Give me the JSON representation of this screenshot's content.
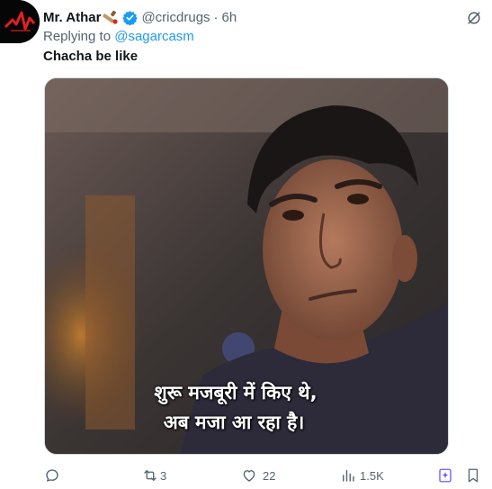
{
  "tweet": {
    "author_name": "Mr. Athar",
    "handle": "@cricdrugs",
    "separator": "·",
    "time": "6h",
    "replying_prefix": "Replying to",
    "replying_to": "@sagarcasm",
    "text": "Chacha be like"
  },
  "media": {
    "subtitle_line1": "शुरू मजबूरी में किए थे,",
    "subtitle_line2": "अब मजा आ रहा है।"
  },
  "actions": {
    "replies": "",
    "retweets": "3",
    "likes": "22",
    "views": "1.5K"
  },
  "icons": [
    "verified-icon",
    "bat-emoji-icon",
    "grok-icon",
    "reply-icon",
    "retweet-icon",
    "like-icon",
    "views-icon",
    "grok-explain-icon",
    "bookmark-icon"
  ],
  "colors": {
    "link": "#1d9bf0",
    "muted": "#536471",
    "text": "#0f1419",
    "accent": "#7856ff"
  }
}
